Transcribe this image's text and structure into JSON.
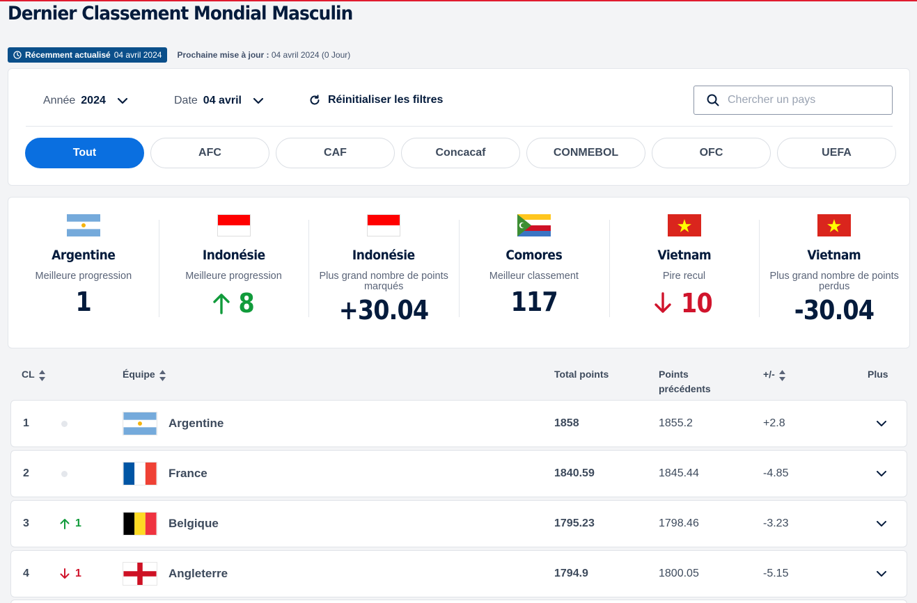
{
  "header": {
    "title": "Dernier Classement Mondial Masculin",
    "badge_label": "Récemment actualisé",
    "badge_date": "04 avril 2024",
    "next_label": "Prochaine mise à jour :",
    "next_value": "04 avril 2024 (0 Jour)"
  },
  "filters": {
    "year_label": "Année",
    "year_value": "2024",
    "date_label": "Date",
    "date_value": "04 avril",
    "reset_label": "Réinitialiser les filtres",
    "search_placeholder": "Chercher un pays"
  },
  "tabs": [
    {
      "label": "Tout",
      "active": true
    },
    {
      "label": "AFC"
    },
    {
      "label": "CAF"
    },
    {
      "label": "Concacaf"
    },
    {
      "label": "CONMEBOL"
    },
    {
      "label": "OFC"
    },
    {
      "label": "UEFA"
    }
  ],
  "stats": [
    {
      "country": "Argentine",
      "desc": "Meilleure progression",
      "value": "1",
      "flag": "argentina"
    },
    {
      "country": "Indonésie",
      "desc": "Meilleure progression",
      "value": "8",
      "direction": "up",
      "flag": "indonesia"
    },
    {
      "country": "Indonésie",
      "desc": "Plus grand nombre de points marqués",
      "value": "+30.04",
      "flag": "indonesia"
    },
    {
      "country": "Comores",
      "desc": "Meilleur classement",
      "value": "117",
      "flag": "comoros"
    },
    {
      "country": "Vietnam",
      "desc": "Pire recul",
      "value": "10",
      "direction": "down",
      "flag": "vietnam"
    },
    {
      "country": "Vietnam",
      "desc": "Plus grand nombre de points perdus",
      "value": "-30.04",
      "flag": "vietnam"
    }
  ],
  "table": {
    "headers": {
      "rank": "CL",
      "team": "Équipe",
      "total": "Total points",
      "prev_line1": "Points",
      "prev_line2": "précédents",
      "diff": "+/-",
      "more": "Plus"
    },
    "rows": [
      {
        "rank": "1",
        "move": "",
        "team": "Argentine",
        "flag": "argentina",
        "total": "1858",
        "prev": "1855.2",
        "diff": "+2.8"
      },
      {
        "rank": "2",
        "move": "",
        "team": "France",
        "flag": "france",
        "total": "1840.59",
        "prev": "1845.44",
        "diff": "-4.85"
      },
      {
        "rank": "3",
        "move": "1",
        "direction": "up",
        "team": "Belgique",
        "flag": "belgium",
        "total": "1795.23",
        "prev": "1798.46",
        "diff": "-3.23"
      },
      {
        "rank": "4",
        "move": "1",
        "direction": "down",
        "team": "Angleterre",
        "flag": "england",
        "total": "1794.9",
        "prev": "1800.05",
        "diff": "-5.15"
      }
    ]
  },
  "colors": {
    "accent": "#0a6fe0",
    "badge": "#0b4f8a",
    "up": "#119b3b",
    "down": "#d0142c",
    "text": "#041b3c"
  }
}
